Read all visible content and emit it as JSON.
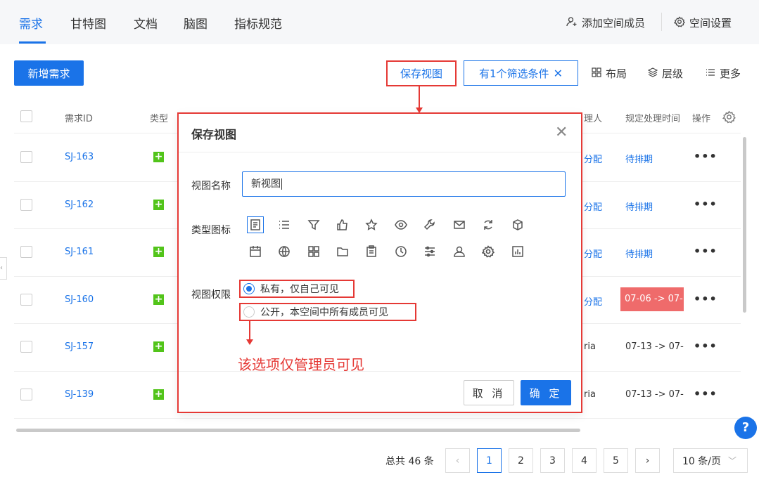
{
  "nav": {
    "tabs": [
      "需求",
      "甘特图",
      "文档",
      "脑图",
      "指标规范"
    ],
    "active_index": 0,
    "add_member": "添加空间成员",
    "space_settings": "空间设置"
  },
  "toolbar": {
    "new_requirement": "新增需求",
    "save_view": "保存视图",
    "filter_label": "有1个筛选条件",
    "layout": "布局",
    "level": "层级",
    "more": "更多"
  },
  "table": {
    "headers": {
      "id": "需求ID",
      "type": "类型",
      "handler": "理人",
      "deadline": "规定处理时间",
      "actions": "操作"
    },
    "rows": [
      {
        "id": "SJ-163",
        "assignee": "分配",
        "schedule": "待排期"
      },
      {
        "id": "SJ-162",
        "assignee": "分配",
        "schedule": "待排期"
      },
      {
        "id": "SJ-161",
        "assignee": "分配",
        "schedule": "待排期"
      },
      {
        "id": "SJ-160",
        "assignee": "分配",
        "schedule": "07-06 -> 07-"
      },
      {
        "id": "SJ-157",
        "assignee": "ria",
        "schedule": "07-13 -> 07-"
      },
      {
        "id": "SJ-139",
        "assignee": "ria",
        "schedule": "07-13 -> 07-"
      }
    ],
    "more_glyph": "•••"
  },
  "pagination": {
    "total": "总共 46 条",
    "pages": [
      "1",
      "2",
      "3",
      "4",
      "5"
    ],
    "active_page": "1",
    "page_size": "10 条/页"
  },
  "modal": {
    "title": "保存视图",
    "name_label": "视图名称",
    "name_value": "新视图",
    "icon_label": "类型图标",
    "icons_row1": [
      "document-icon",
      "list-icon",
      "filter-icon",
      "thumbs-up-icon",
      "star-icon",
      "eye-icon",
      "wrench-icon",
      "mail-icon",
      "refresh-icon",
      "cube-icon"
    ],
    "icons_row2": [
      "calendar-icon",
      "globe-icon",
      "grid-icon",
      "folder-icon",
      "clipboard-icon",
      "clock-icon",
      "sliders-icon",
      "user-icon",
      "gear-icon",
      "bar-chart-icon"
    ],
    "permission_label": "视图权限",
    "option_private": "私有，仅自己可见",
    "option_public": "公开，本空间中所有成员可见",
    "cancel": "取 消",
    "confirm": "确 定"
  },
  "annotation": "该选项仅管理员可见",
  "colors": {
    "accent": "#1a73e8",
    "annotation_red": "#e53935",
    "type_green": "#52c41a",
    "overdue": "#ef6b6b"
  }
}
